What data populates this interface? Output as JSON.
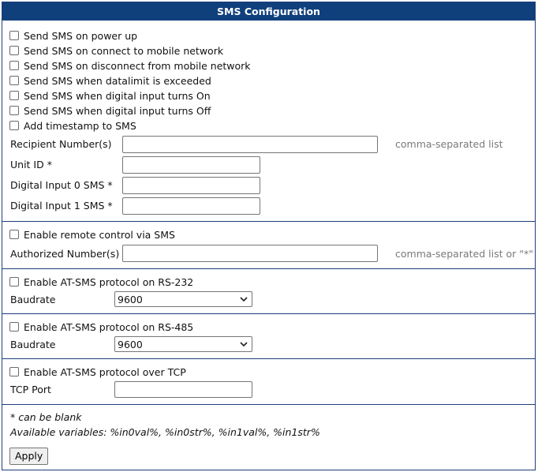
{
  "header": {
    "title": "SMS Configuration"
  },
  "send_options": [
    {
      "label": "Send SMS on power up",
      "checked": false
    },
    {
      "label": "Send SMS on connect to mobile network",
      "checked": false
    },
    {
      "label": "Send SMS on disconnect from mobile network",
      "checked": false
    },
    {
      "label": "Send SMS when datalimit is exceeded",
      "checked": false
    },
    {
      "label": "Send SMS when digital input turns On",
      "checked": false
    },
    {
      "label": "Send SMS when digital input turns Off",
      "checked": false
    },
    {
      "label": "Add timestamp to SMS",
      "checked": false
    }
  ],
  "fields": {
    "recipient": {
      "label": "Recipient Number(s)",
      "value": "",
      "hint": "comma-separated list"
    },
    "unit_id": {
      "label": "Unit ID *",
      "value": ""
    },
    "di0": {
      "label": "Digital Input 0 SMS *",
      "value": ""
    },
    "di1": {
      "label": "Digital Input 1 SMS *",
      "value": ""
    }
  },
  "remote": {
    "enable_label": "Enable remote control via SMS",
    "authorized_label": "Authorized Number(s)",
    "authorized_value": "",
    "hint": "comma-separated list or \"*\""
  },
  "rs232": {
    "enable_label": "Enable AT-SMS protocol on RS-232",
    "baud_label": "Baudrate",
    "baud_value": "9600"
  },
  "rs485": {
    "enable_label": "Enable AT-SMS protocol on RS-485",
    "baud_label": "Baudrate",
    "baud_value": "9600"
  },
  "tcp": {
    "enable_label": "Enable AT-SMS protocol over TCP",
    "port_label": "TCP Port",
    "port_value": ""
  },
  "notes": {
    "blank": "* can be blank",
    "variables": "Available variables: %in0val%, %in0str%, %in1val%, %in1str%"
  },
  "apply_label": "Apply",
  "colors": {
    "header_bg": "#10407c",
    "border": "#1c3f7a",
    "hint": "#7a7a7a"
  },
  "icons": {
    "select_arrow": "chevron-down-icon"
  }
}
